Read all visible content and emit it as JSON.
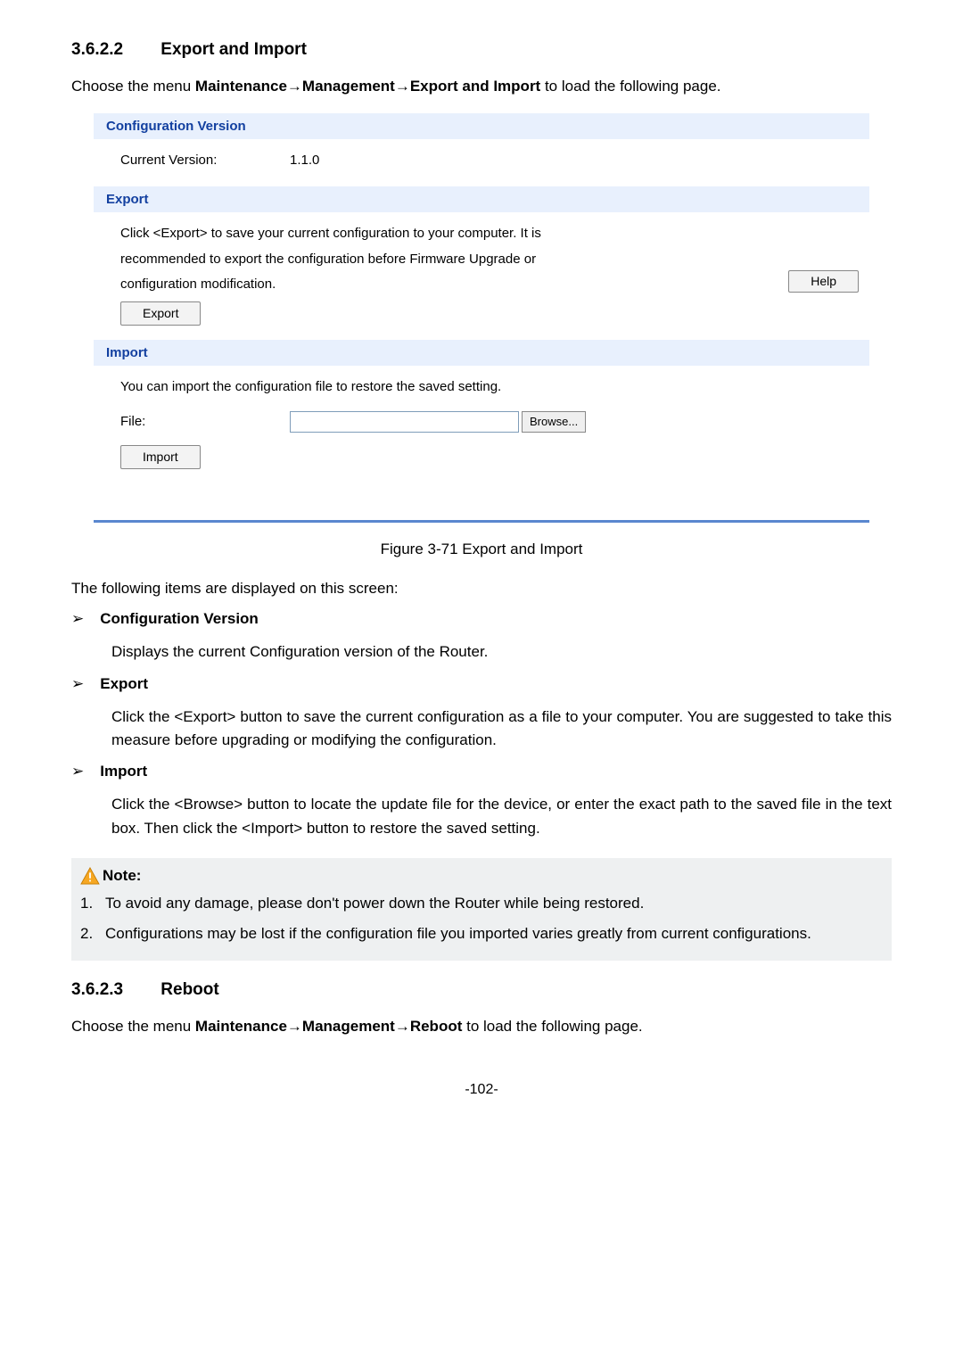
{
  "section1": {
    "number": "3.6.2.2",
    "title": "Export and Import",
    "intro_parts": [
      "Choose the menu ",
      "Maintenance",
      "→",
      "Management",
      "→",
      "Export and Import",
      " to load the following page."
    ]
  },
  "panel": {
    "config_version": {
      "header": "Configuration Version",
      "label": "Current Version:",
      "value": "1.1.0"
    },
    "export": {
      "header": "Export",
      "line1": "Click <Export> to save your current configuration to your computer. It is",
      "line2": "recommended to export the configuration before Firmware Upgrade or",
      "line3": "configuration modification.",
      "export_btn": "Export",
      "help_btn": "Help"
    },
    "import": {
      "header": "Import",
      "line1": "You can import the configuration file to restore the saved setting.",
      "file_label": "File:",
      "browse_btn": "Browse...",
      "import_btn": "Import"
    }
  },
  "caption": "Figure 3-71 Export and Import",
  "displayed_line": "The following items are displayed on this screen:",
  "items": [
    {
      "title": "Configuration Version",
      "body": "Displays the current Configuration version of the Router."
    },
    {
      "title": "Export",
      "body": "Click the <Export> button to save the current configuration as a file to your computer. You are suggested to take this measure before upgrading or modifying the configuration."
    },
    {
      "title": "Import",
      "body": "Click the <Browse> button to locate the update file for the device, or enter the exact path to the saved file in the text box. Then click the <Import> button to restore the saved setting."
    }
  ],
  "note": {
    "title": "Note:",
    "items": [
      "To avoid any damage, please don't power down the Router while being restored.",
      "Configurations may be lost if the configuration file you imported varies greatly from current configurations."
    ]
  },
  "section2": {
    "number": "3.6.2.3",
    "title": "Reboot",
    "intro_parts": [
      "Choose the menu ",
      "Maintenance",
      "→",
      "Management",
      "→",
      "Reboot",
      " to load the following page."
    ]
  },
  "page_number": "-102-"
}
